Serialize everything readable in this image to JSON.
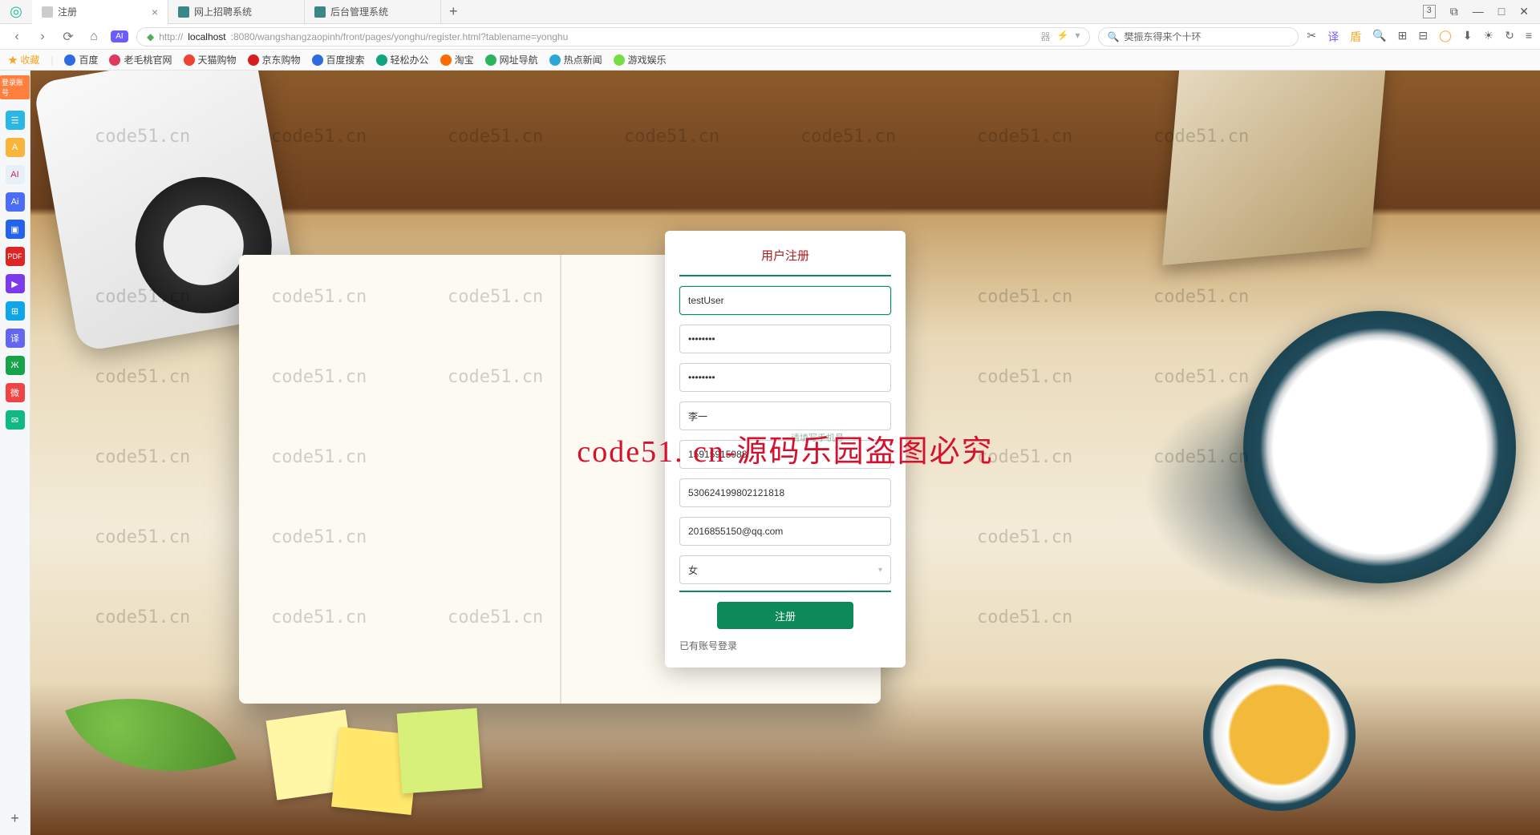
{
  "browser": {
    "tabs": [
      {
        "title": "注册",
        "active": true
      },
      {
        "title": "网上招聘系统",
        "active": false
      },
      {
        "title": "后台管理系统",
        "active": false
      }
    ],
    "new_tab": "+",
    "window_controls": {
      "count_badge": "3",
      "min": "—",
      "max": "□",
      "close": "✕"
    },
    "nav": {
      "back": "‹",
      "forward": "›",
      "reload": "⟳",
      "home": "⌂"
    },
    "url_prefix": "http://",
    "url_host": "localhost",
    "url_rest": ":8080/wangshangzaopinh/front/pages/yonghu/register.html?tablename=yonghu",
    "url_tools": [
      "器",
      "⚡",
      "▾"
    ],
    "search_icon": "🔍",
    "search_placeholder": "樊振东得来个十环",
    "right_tools": [
      "✂",
      "译",
      "盾",
      "🔍",
      "⊞",
      "⊟",
      "◯",
      "⬇",
      "☀",
      "↻",
      "≡"
    ]
  },
  "bookmarks": {
    "fav_label": "★ 收藏",
    "items": [
      "百度",
      "老毛桃官网",
      "天猫购物",
      "京东购物",
      "百度搜索",
      "轻松办公",
      "淘宝",
      "网址导航",
      "热点新闻",
      "游戏娱乐"
    ]
  },
  "dock": {
    "login_tag": "登录账号",
    "items": [
      "☰",
      "A",
      "AI",
      "Ai",
      "▣",
      "PDF",
      "▶",
      "⊞",
      "译",
      "Ж",
      "微",
      "✉"
    ]
  },
  "watermarks": {
    "text": "code51.cn",
    "overlay": "code51. cn-源码乐园盗图必究"
  },
  "register": {
    "title": "用户注册",
    "username": "testUser",
    "password": "••••••••",
    "confirm": "••••••••",
    "realname": "李一",
    "phone_hint": "请填写手机号",
    "phone": "15915915988",
    "idcard": "530624199802121818",
    "email": "2016855150@qq.com",
    "gender": "女",
    "submit": "注册",
    "login_link": "已有账号登录"
  }
}
